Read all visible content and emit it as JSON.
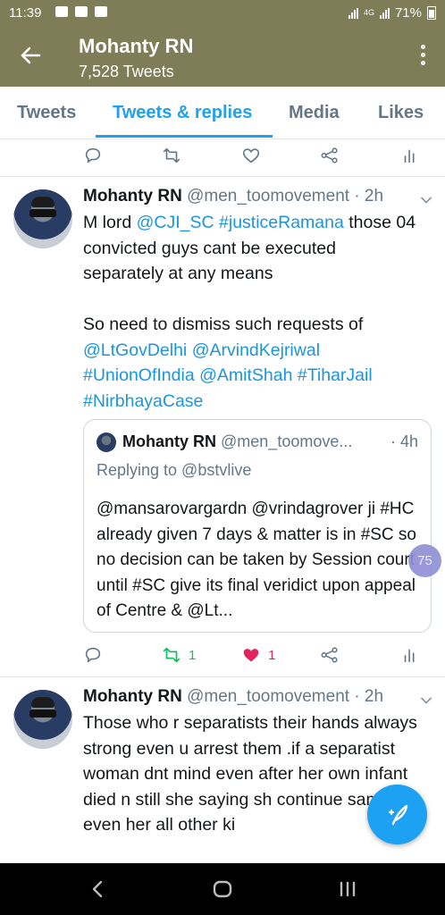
{
  "status_bar": {
    "time": "11:39",
    "network": "4G",
    "battery": "71%"
  },
  "header": {
    "title": "Mohanty RN",
    "subtitle": "7,528 Tweets"
  },
  "tabs": [
    {
      "label": "Tweets",
      "active": false
    },
    {
      "label": "Tweets & replies",
      "active": true
    },
    {
      "label": "Media",
      "active": false
    },
    {
      "label": "Likes",
      "active": false
    }
  ],
  "tweets": [
    {
      "name": "Mohanty RN",
      "handle": "@men_toomovement · 2h",
      "text_lines": [
        [
          {
            "t": "M lord "
          },
          {
            "t": "@CJI_SC",
            "link": true
          },
          {
            "t": " "
          },
          {
            "t": "#justiceRamana",
            "link": true
          },
          {
            "t": " those 04"
          }
        ],
        [
          {
            "t": "convicted guys cant be executed"
          }
        ],
        [
          {
            "t": "separately at any means"
          }
        ],
        [
          {
            "t": ""
          }
        ],
        [
          {
            "t": "So need to dismiss such requests of"
          }
        ],
        [
          {
            "t": "@LtGovDelhi",
            "link": true
          },
          {
            "t": " "
          },
          {
            "t": "@ArvindKejriwal",
            "link": true
          }
        ],
        [
          {
            "t": "#UnionOfIndia",
            "link": true
          },
          {
            "t": " "
          },
          {
            "t": "@AmitShah",
            "link": true
          },
          {
            "t": " "
          },
          {
            "t": "#TiharJail",
            "link": true
          }
        ],
        [
          {
            "t": "#NirbhayaCase",
            "link": true
          }
        ]
      ],
      "quote": {
        "name": "Mohanty RN",
        "handle": "@men_toomove...",
        "time": "· 4h",
        "replying": "Replying to @bstvlive",
        "text": "@mansarovargardn @vrindagrover ji #HC already given 7 days & matter is in #SC so no decision can be taken by Session court until #SC give its final veridict upon appeal of Centre & @Lt..."
      },
      "retweets": "1",
      "likes": "1"
    },
    {
      "name": "Mohanty RN",
      "handle": "@men_toomovement · 2h",
      "text": "Those who r separatists their hands always strong even u arrest them .if a separatist woman dnt mind even after her own infant died n still she saying sh continue same even her all other ki"
    }
  ],
  "floating_badge": "75",
  "colors": {
    "header_bg": "#7e7d58",
    "accent": "#1da1f2",
    "retweet_green": "#17bf63",
    "like_red": "#e0245e"
  }
}
